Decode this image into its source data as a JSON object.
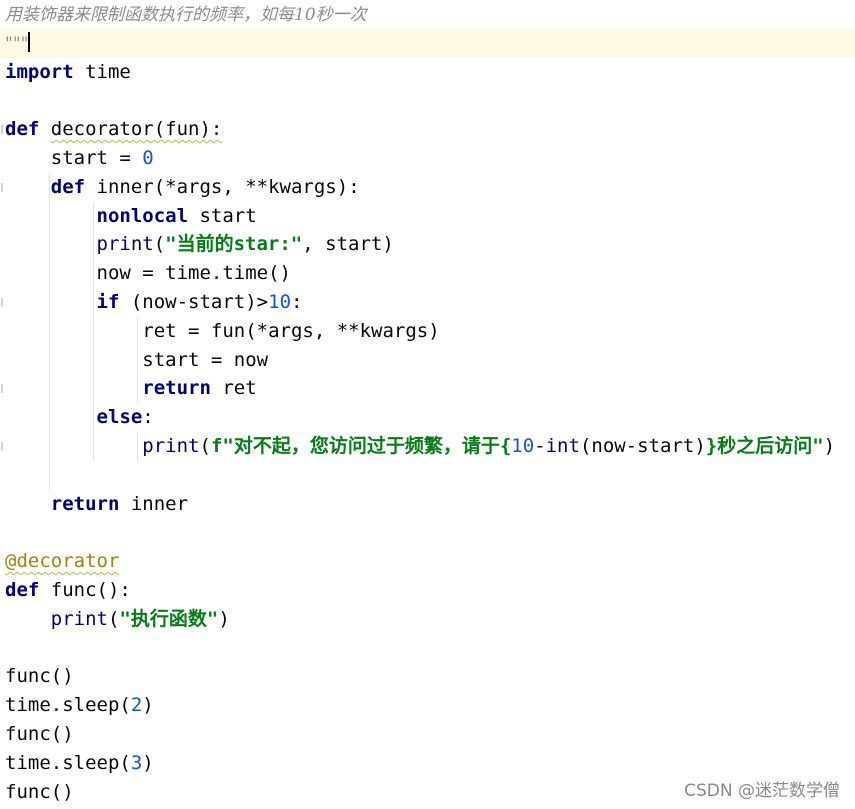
{
  "lines": [
    {
      "seg": [
        {
          "t": "用装饰器来限制函数执行的频率，如每10秒一次",
          "c": "cmt"
        }
      ]
    },
    {
      "seg": [
        {
          "t": "\"\"\"",
          "c": "cmt"
        }
      ],
      "current": true,
      "caret": true
    },
    {
      "seg": [
        {
          "t": "import",
          "c": "kw"
        },
        {
          "t": " time"
        }
      ]
    },
    {
      "seg": []
    },
    {
      "seg": [
        {
          "t": "def",
          "c": "kw"
        },
        {
          "t": " "
        },
        {
          "t": "decorator(fun):",
          "c": "wave"
        }
      ],
      "fold": true
    },
    {
      "seg": [
        {
          "t": "    start = "
        },
        {
          "t": "0",
          "c": "num"
        }
      ]
    },
    {
      "seg": [
        {
          "t": "    "
        },
        {
          "t": "def",
          "c": "kw"
        },
        {
          "t": " inner(*args, **kwargs):"
        }
      ],
      "fold": true,
      "guides": [
        1
      ]
    },
    {
      "seg": [
        {
          "t": "        "
        },
        {
          "t": "nonlocal",
          "c": "kw"
        },
        {
          "t": " start"
        }
      ],
      "guides": [
        1,
        2
      ]
    },
    {
      "seg": [
        {
          "t": "        "
        },
        {
          "t": "print",
          "c": "bi"
        },
        {
          "t": "("
        },
        {
          "t": "\"当前的star:\"",
          "c": "str"
        },
        {
          "t": ", start)"
        }
      ],
      "guides": [
        1,
        2
      ]
    },
    {
      "seg": [
        {
          "t": "        now = time.time()"
        }
      ],
      "guides": [
        1,
        2
      ]
    },
    {
      "seg": [
        {
          "t": "        "
        },
        {
          "t": "if",
          "c": "kw"
        },
        {
          "t": " (now-start)>"
        },
        {
          "t": "10",
          "c": "num"
        },
        {
          "t": ":"
        }
      ],
      "fold": true,
      "guides": [
        1,
        2
      ]
    },
    {
      "seg": [
        {
          "t": "            ret = fun(*args, **kwargs)"
        }
      ],
      "guides": [
        1,
        2,
        3
      ]
    },
    {
      "seg": [
        {
          "t": "            start = now"
        }
      ],
      "guides": [
        1,
        2,
        3
      ]
    },
    {
      "seg": [
        {
          "t": "            "
        },
        {
          "t": "return",
          "c": "kw"
        },
        {
          "t": " ret"
        }
      ],
      "fold": true,
      "guides": [
        1,
        2,
        3
      ]
    },
    {
      "seg": [
        {
          "t": "        "
        },
        {
          "t": "else",
          "c": "kw"
        },
        {
          "t": ":"
        }
      ],
      "guides": [
        1,
        2
      ]
    },
    {
      "seg": [
        {
          "t": "            "
        },
        {
          "t": "print",
          "c": "bi"
        },
        {
          "t": "("
        },
        {
          "t": "f\"对不起，您访问过于频繁，请于{",
          "c": "str"
        },
        {
          "t": "10",
          "c": "num"
        },
        {
          "t": "-"
        },
        {
          "t": "int",
          "c": "bi"
        },
        {
          "t": "(now-start)"
        },
        {
          "t": "}秒之后访问\"",
          "c": "str"
        },
        {
          "t": ")"
        }
      ],
      "fold": true,
      "guides": [
        1,
        2,
        3
      ]
    },
    {
      "seg": [],
      "guides": [
        1
      ]
    },
    {
      "seg": [
        {
          "t": "    "
        },
        {
          "t": "return",
          "c": "kw"
        },
        {
          "t": " inner"
        }
      ]
    },
    {
      "seg": []
    },
    {
      "seg": [
        {
          "t": "@decorator",
          "c": "deco wave"
        }
      ]
    },
    {
      "seg": [
        {
          "t": "def",
          "c": "kw"
        },
        {
          "t": " func():"
        }
      ]
    },
    {
      "seg": [
        {
          "t": "    "
        },
        {
          "t": "print",
          "c": "bi"
        },
        {
          "t": "("
        },
        {
          "t": "\"执行函数\"",
          "c": "str"
        },
        {
          "t": ")"
        }
      ]
    },
    {
      "seg": []
    },
    {
      "seg": [
        {
          "t": "func()"
        }
      ]
    },
    {
      "seg": [
        {
          "t": "time.sleep("
        },
        {
          "t": "2",
          "c": "num"
        },
        {
          "t": ")"
        }
      ]
    },
    {
      "seg": [
        {
          "t": "func()"
        }
      ]
    },
    {
      "seg": [
        {
          "t": "time.sleep("
        },
        {
          "t": "3",
          "c": "num"
        },
        {
          "t": ")"
        }
      ]
    },
    {
      "seg": [
        {
          "t": "func()"
        }
      ]
    }
  ],
  "watermark": "CSDN @迷茫数学僧"
}
